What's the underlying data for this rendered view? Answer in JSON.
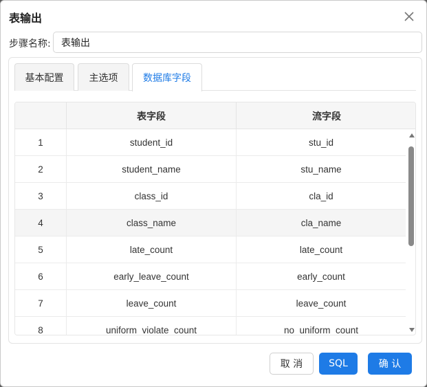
{
  "dialog": {
    "title": "表输出",
    "close_icon": "close-icon"
  },
  "step": {
    "label": "步骤名称:",
    "value": "表输出"
  },
  "tabs": [
    {
      "label": "基本配置",
      "active": false
    },
    {
      "label": "主选项",
      "active": false
    },
    {
      "label": "数据库字段",
      "active": true
    }
  ],
  "table": {
    "columns": [
      "",
      "表字段",
      "流字段"
    ],
    "rows": [
      {
        "index": "1",
        "table_field": "student_id",
        "stream_field": "stu_id"
      },
      {
        "index": "2",
        "table_field": "student_name",
        "stream_field": "stu_name"
      },
      {
        "index": "3",
        "table_field": "class_id",
        "stream_field": "cla_id"
      },
      {
        "index": "4",
        "table_field": "class_name",
        "stream_field": "cla_name"
      },
      {
        "index": "5",
        "table_field": "late_count",
        "stream_field": "late_count"
      },
      {
        "index": "6",
        "table_field": "early_leave_count",
        "stream_field": "early_count"
      },
      {
        "index": "7",
        "table_field": "leave_count",
        "stream_field": "leave_count"
      },
      {
        "index": "8",
        "table_field": "uniform_violate_count",
        "stream_field": "no_uniform_count"
      }
    ]
  },
  "buttons": {
    "cancel": "取 消",
    "sql": "SQL",
    "ok": "确 认"
  },
  "colors": {
    "accent": "#1e7be6",
    "highlight_row": "#f5f5f5"
  }
}
